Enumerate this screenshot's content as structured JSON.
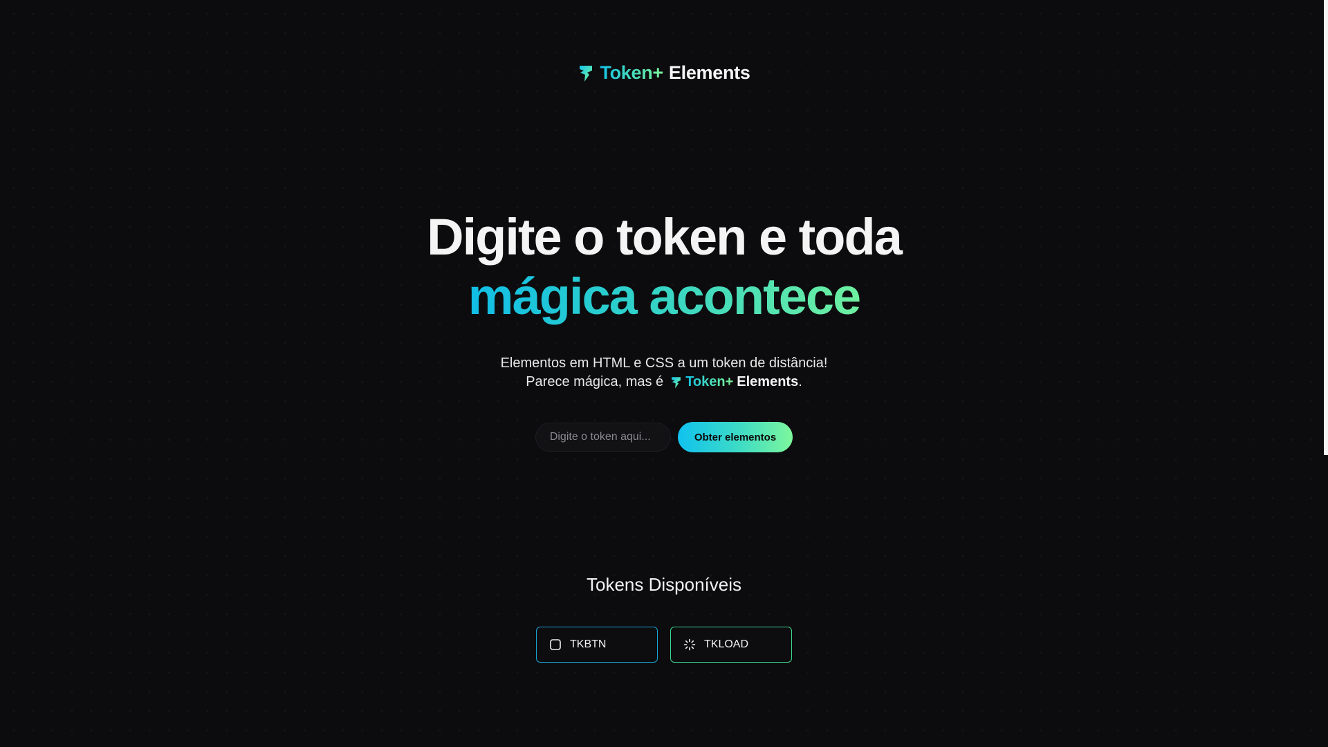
{
  "header": {
    "logo_grad": "Token+",
    "logo_white": "Elements",
    "logo_icon": "token-plus-logo-icon"
  },
  "hero": {
    "line1": "Digite o token e toda",
    "line2": "mágica acontece"
  },
  "subtitle": {
    "line1": "Elementos em HTML e CSS a um token de distância!",
    "line2_prefix": "Parece mágica, mas é",
    "brand_grad": "Token+",
    "brand_white": "Elements",
    "line2_suffix": "."
  },
  "form": {
    "input_placeholder": "Digite o token aqui...",
    "input_value": "",
    "submit_label": "Obter elementos"
  },
  "tokens_section": {
    "title": "Tokens Disponíveis",
    "items": [
      {
        "label": "TKBTN",
        "icon": "square-button-icon",
        "accent": "#1aa4d6"
      },
      {
        "label": "TKLOAD",
        "icon": "loading-spinner-icon",
        "accent": "#3ed88e"
      }
    ]
  },
  "colors": {
    "background": "#0c0c0e",
    "gradient_start": "#11bde6",
    "gradient_end": "#7ef79c",
    "text": "#f2f2f2"
  }
}
